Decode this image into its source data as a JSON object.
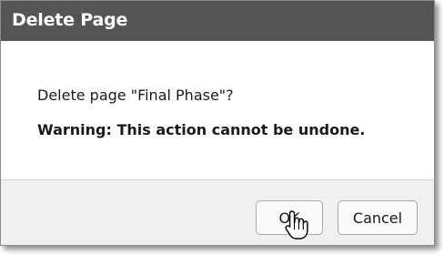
{
  "dialog": {
    "title": "Delete Page",
    "question": "Delete page \"Final Phase\"?",
    "warning": "Warning: This action cannot be undone.",
    "buttons": {
      "ok_label": "OK",
      "cancel_label": "Cancel"
    }
  },
  "cursor": {
    "icon": "hand-pointer-icon"
  },
  "colors": {
    "titlebar": "#555555",
    "footer": "#f0f0f0"
  }
}
